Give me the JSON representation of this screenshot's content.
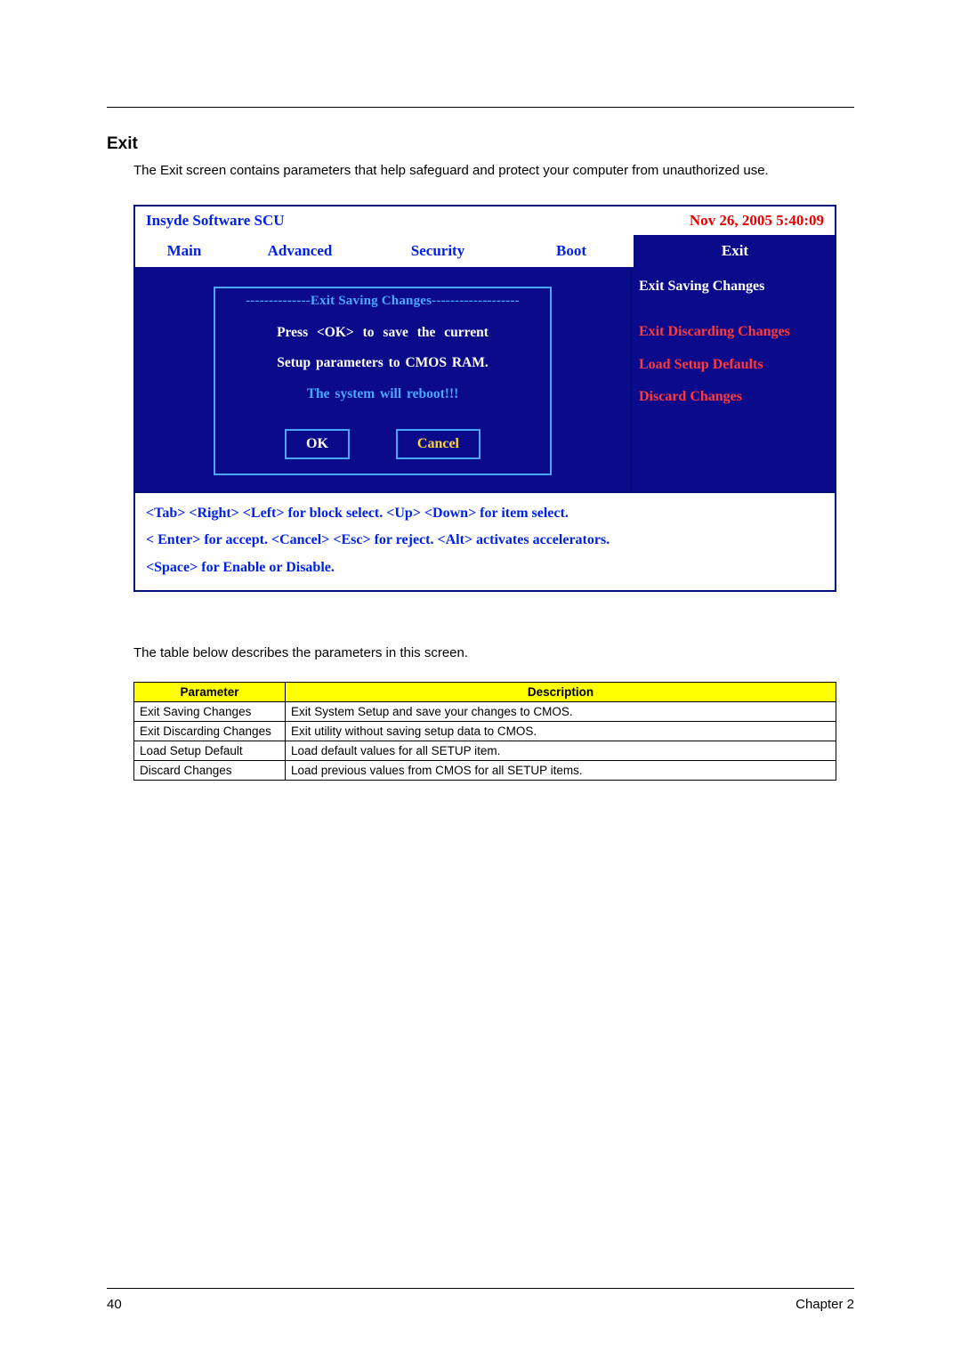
{
  "heading": "Exit",
  "intro": "The Exit screen contains parameters that help safeguard and protect your computer from unauthorized use.",
  "bios": {
    "title_left": "Insyde Software SCU",
    "title_right": "Nov 26, 2005 5:40:09",
    "tabs": {
      "main": "Main",
      "advanced": "Advanced",
      "security": "Security",
      "boot": "Boot",
      "exit": "Exit"
    },
    "right_menu": {
      "selected": "Exit Saving Changes",
      "items": [
        "Exit Discarding Changes",
        "Load Setup Defaults",
        "Discard Changes"
      ]
    },
    "dialog": {
      "title": "--------------Exit Saving Changes-------------------",
      "line1": "Press  <OK>  to  save  the current",
      "line2": "Setup parameters to CMOS RAM.",
      "line3": "The system will reboot!!!",
      "ok": "OK",
      "cancel": "Cancel"
    },
    "footer": {
      "line1": "<Tab> <Right> <Left> for block select.   <Up> <Down> for item select.",
      "line2": "< Enter> for accept. <Cancel> <Esc> for reject. <Alt> activates accelerators.",
      "line3": "<Space> for Enable or Disable."
    }
  },
  "table_intro": "The table below describes the parameters in this screen.",
  "table": {
    "head_param": "Parameter",
    "head_desc": "Description",
    "rows": [
      {
        "p": "Exit Saving Changes",
        "d": "Exit System Setup and save your changes to CMOS."
      },
      {
        "p": "Exit Discarding Changes",
        "d": "Exit utility without saving setup data to CMOS."
      },
      {
        "p": "Load Setup Default",
        "d": "Load default values for all SETUP item."
      },
      {
        "p": "Discard Changes",
        "d": "Load previous values from CMOS for all SETUP items."
      }
    ]
  },
  "footer_page": "40",
  "footer_chapter": "Chapter 2"
}
